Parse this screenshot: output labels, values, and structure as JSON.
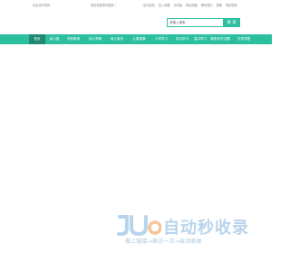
{
  "topbar": {
    "left_text": "欢迎访问本网",
    "mid_text": "您还未登录请登录 | ",
    "links": [
      "设为首页",
      "加入收藏",
      "手机版",
      "网站地图",
      "联系我们",
      "投稿",
      "网站导航"
    ]
  },
  "search": {
    "placeholder": "",
    "value": "请输入搜索",
    "button_label": "搜 索"
  },
  "nav": {
    "items": [
      "首页",
      "幼儿园",
      "学前教育",
      "幼儿早教",
      "育儿常识",
      "儿童故事",
      "小学学习",
      "初中学习",
      "高中学习",
      "期末考试试题",
      "文学学园"
    ],
    "active_index": 0,
    "bg_color": "#2bbfa0",
    "active_color": "#1f8a73"
  },
  "watermark": {
    "logo_icon": "jiyun-logo-icon",
    "title": "自动秒收录",
    "subtitle": "做上链接→来访一次→自动收录"
  }
}
